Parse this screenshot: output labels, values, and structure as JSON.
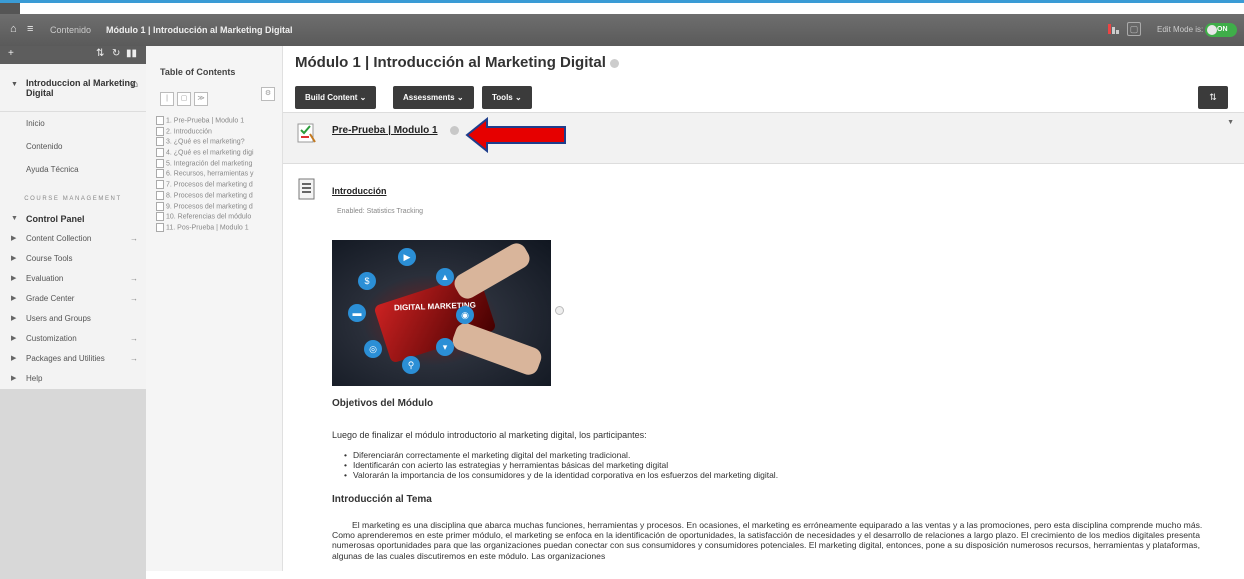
{
  "topbar": {
    "breadcrumb_root": "Contenido",
    "breadcrumb_current": "Módulo 1 | Introducción al Marketing Digital",
    "edit_mode_label": "Edit Mode is:",
    "edit_mode_state": "ON"
  },
  "leftrail": {
    "course_title": "Introduccion al Marketing Digital",
    "nav": [
      "Inicio",
      "Contenido",
      "Ayuda Técnica"
    ],
    "management_title": "COURSE MANAGEMENT",
    "control_panel": "Control Panel",
    "panel_items": [
      "Content Collection",
      "Course Tools",
      "Evaluation",
      "Grade Center",
      "Users and Groups",
      "Customization",
      "Packages and Utilities",
      "Help"
    ]
  },
  "toc": {
    "title": "Table of Contents",
    "items": [
      "1. Pre-Prueba | Modulo 1",
      "2. Introducción",
      "3. ¿Qué es el marketing?",
      "4. ¿Qué es el marketing digi",
      "5. Integración del marketing",
      "6. Recursos, herramientas y",
      "7. Procesos del marketing d",
      "8. Procesos del marketing d",
      "9. Procesos del marketing d",
      "10. Referencias del módulo",
      "11. Pos-Prueba | Modulo 1"
    ]
  },
  "main": {
    "page_title": "Módulo 1 | Introducción al Marketing Digital",
    "buttons": {
      "build": "Build Content",
      "assessments": "Assessments",
      "tools": "Tools"
    },
    "item1_title": "Pre-Prueba | Modulo 1",
    "item2_title": "Introducción",
    "item2_enabled": "Enabled:  Statistics Tracking",
    "image_text": "DIGITAL MARKETING",
    "objectives_heading": "Objetivos del Módulo",
    "objectives_intro": "Luego de finalizar el módulo introductorio al marketing digital, los participantes:",
    "bullets": [
      "Diferenciarán correctamente el marketing digital del marketing tradicional.",
      "Identificarán con acierto las estrategias y herramientas básicas del marketing digital",
      "Valorarán la importancia de los consumidores y de la identidad corporativa en los esfuerzos del marketing digital."
    ],
    "intro_heading": "Introducción al Tema",
    "intro_paragraph": "El marketing es una disciplina que abarca muchas funciones, herramientas y procesos.  En ocasiones, el marketing es erróneamente equiparado a las ventas y a las promociones, pero esta disciplina comprende mucho más.  Como aprenderemos en este primer módulo, el marketing se enfoca en la identificación de oportunidades, la satisfacción de necesidades y el desarrollo de relaciones a largo plazo.  El crecimiento de los medios digitales presenta numerosas oportunidades para que las organizaciones puedan conectar con sus consumidores y consumidores potenciales.  El marketing digital, entonces, pone a su disposición numerosos recursos, herramientas y plataformas, algunas de las cuales discutiremos en este módulo.  Las organizaciones"
  },
  "colors": {
    "toggle_on": "#3fae49",
    "dark_button": "#3b3b3b",
    "arrow_red": "#e60000"
  }
}
